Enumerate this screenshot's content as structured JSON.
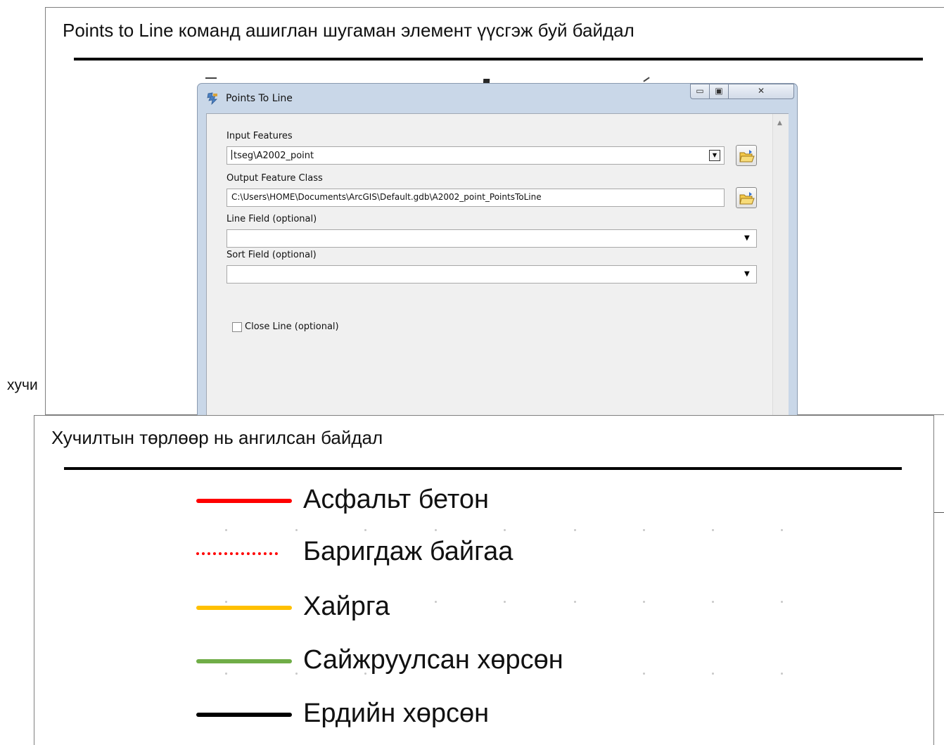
{
  "top_panel": {
    "title": "Points to Line команд ашиглан шугаман элемент үүсгэж буй байдал"
  },
  "side_text": "хучи",
  "dialog": {
    "title": "Points To Line",
    "controls": {
      "minimize": "▭",
      "maximize": "▣",
      "close": "✕"
    },
    "input_features": {
      "label": "Input Features",
      "value": "tseg\\A2002_point"
    },
    "output_feature_class": {
      "label": "Output Feature Class",
      "value": "C:\\Users\\HOME\\Documents\\ArcGIS\\Default.gdb\\A2002_point_PointsToLine"
    },
    "line_field": {
      "label": "Line Field (optional)",
      "value": ""
    },
    "sort_field": {
      "label": "Sort Field (optional)",
      "value": ""
    },
    "close_line": {
      "label": "Close Line (optional)",
      "checked": false
    }
  },
  "bottom_panel": {
    "title": "Хучилтын төрлөөр нь ангилсан байдал",
    "legend": [
      {
        "label": "Асфальт бетон",
        "color": "#ff0000",
        "style": "solid"
      },
      {
        "label": "Баригдаж байгаа",
        "color": "#ff0000",
        "style": "dotted"
      },
      {
        "label": "Хайрга",
        "color": "#ffc000",
        "style": "solid"
      },
      {
        "label": "Сайжруулсан хөрсөн",
        "color": "#70ad47",
        "style": "solid"
      },
      {
        "label": "Ердийн хөрсөн",
        "color": "#000000",
        "style": "solid"
      }
    ]
  }
}
